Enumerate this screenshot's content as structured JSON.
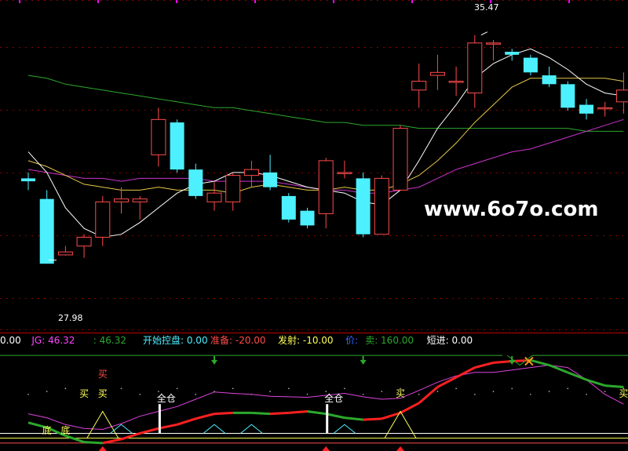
{
  "colors": {
    "up": "#ff4b4b",
    "down": "#4cf0ff",
    "ma_fast": "#ffffff",
    "ma_mid": "#e6c84a",
    "ma_slow": "#cc33cc",
    "ma_long": "#2ca82c",
    "grid": "#8a0000"
  },
  "watermark": "www.6o7o.com",
  "chart_data": [
    {
      "type": "candlestick",
      "ylim": [
        26.0,
        36.5
      ],
      "high_label": "35.47",
      "low_label": "27.98",
      "candles": [
        {
          "o": 30.6,
          "h": 30.8,
          "l": 30.2,
          "c": 30.5
        },
        {
          "o": 29.9,
          "h": 30.2,
          "l": 27.7,
          "c": 27.7
        },
        {
          "o": 28.0,
          "h": 28.3,
          "l": 27.98,
          "c": 28.1
        },
        {
          "o": 28.3,
          "h": 28.7,
          "l": 27.9,
          "c": 28.6
        },
        {
          "o": 28.6,
          "h": 30.0,
          "l": 28.3,
          "c": 29.8
        },
        {
          "o": 29.8,
          "h": 30.3,
          "l": 29.4,
          "c": 29.9
        },
        {
          "o": 29.8,
          "h": 30.0,
          "l": 29.2,
          "c": 29.9
        },
        {
          "o": 31.4,
          "h": 33.0,
          "l": 31.0,
          "c": 32.6
        },
        {
          "o": 32.5,
          "h": 32.6,
          "l": 30.8,
          "c": 30.9
        },
        {
          "o": 30.9,
          "h": 31.1,
          "l": 29.9,
          "c": 30.0
        },
        {
          "o": 29.8,
          "h": 30.5,
          "l": 29.5,
          "c": 30.1
        },
        {
          "o": 29.8,
          "h": 30.8,
          "l": 29.5,
          "c": 30.7
        },
        {
          "o": 30.7,
          "h": 31.2,
          "l": 30.3,
          "c": 30.9
        },
        {
          "o": 30.8,
          "h": 31.4,
          "l": 30.2,
          "c": 30.3
        },
        {
          "o": 30.0,
          "h": 30.1,
          "l": 29.1,
          "c": 29.2
        },
        {
          "o": 29.5,
          "h": 29.6,
          "l": 28.9,
          "c": 29.0
        },
        {
          "o": 29.4,
          "h": 31.3,
          "l": 28.9,
          "c": 31.2
        },
        {
          "o": 30.8,
          "h": 31.2,
          "l": 30.6,
          "c": 30.8
        },
        {
          "o": 30.6,
          "h": 30.8,
          "l": 28.6,
          "c": 28.7
        },
        {
          "o": 28.7,
          "h": 30.7,
          "l": 28.7,
          "c": 30.6
        },
        {
          "o": 30.2,
          "h": 32.4,
          "l": 30.2,
          "c": 32.3
        },
        {
          "o": 33.6,
          "h": 34.5,
          "l": 33.0,
          "c": 33.9
        },
        {
          "o": 34.1,
          "h": 34.8,
          "l": 33.6,
          "c": 34.2
        },
        {
          "o": 33.9,
          "h": 34.4,
          "l": 33.4,
          "c": 33.9
        },
        {
          "o": 33.5,
          "h": 35.47,
          "l": 33.0,
          "c": 35.2
        },
        {
          "o": 35.2,
          "h": 35.3,
          "l": 34.6,
          "c": 35.2
        },
        {
          "o": 34.9,
          "h": 35.0,
          "l": 34.6,
          "c": 34.8
        },
        {
          "o": 34.7,
          "h": 34.8,
          "l": 34.1,
          "c": 34.2
        },
        {
          "o": 34.1,
          "h": 34.4,
          "l": 33.7,
          "c": 33.8
        },
        {
          "o": 33.8,
          "h": 33.9,
          "l": 32.9,
          "c": 33.0
        },
        {
          "o": 33.1,
          "h": 33.3,
          "l": 32.6,
          "c": 32.8
        },
        {
          "o": 33.0,
          "h": 33.2,
          "l": 32.7,
          "c": 33.0
        },
        {
          "o": 33.2,
          "h": 34.2,
          "l": 32.8,
          "c": 33.6
        }
      ],
      "ma_fast": [
        31.5,
        30.8,
        29.6,
        28.9,
        28.6,
        28.7,
        29.1,
        29.6,
        30.1,
        30.4,
        30.5,
        30.8,
        30.8,
        30.7,
        30.5,
        30.3,
        30.2,
        30.1,
        29.8,
        29.7,
        30.2,
        31.2,
        32.3,
        33.1,
        34.0,
        34.5,
        34.8,
        35.0,
        34.7,
        34.3,
        33.8,
        33.5,
        33.4
      ],
      "ma_mid": [
        31.2,
        31.0,
        30.7,
        30.4,
        30.3,
        30.2,
        30.2,
        30.3,
        30.2,
        30.2,
        30.2,
        30.1,
        30.3,
        30.4,
        30.3,
        30.2,
        30.2,
        30.3,
        30.2,
        30.2,
        30.4,
        30.7,
        31.2,
        31.8,
        32.5,
        33.1,
        33.7,
        34.0,
        34.0,
        34.0,
        34.0,
        34.0,
        33.9
      ],
      "ma_slow": [
        30.9,
        30.8,
        30.7,
        30.6,
        30.6,
        30.5,
        30.6,
        30.6,
        30.6,
        30.6,
        30.5,
        30.5,
        30.5,
        30.5,
        30.4,
        30.3,
        30.2,
        30.2,
        30.1,
        30.1,
        30.2,
        30.3,
        30.6,
        30.9,
        31.1,
        31.3,
        31.5,
        31.6,
        31.8,
        32.0,
        32.2,
        32.4,
        32.6
      ],
      "ma_long": [
        34.1,
        34.0,
        33.8,
        33.7,
        33.6,
        33.5,
        33.4,
        33.3,
        33.2,
        33.1,
        33.0,
        33.0,
        32.9,
        32.8,
        32.7,
        32.6,
        32.5,
        32.5,
        32.4,
        32.4,
        32.4,
        32.3,
        32.3,
        32.3,
        32.3,
        32.3,
        32.3,
        32.3,
        32.3,
        32.3,
        32.2,
        32.2,
        32.2
      ]
    },
    {
      "type": "indicator",
      "legend_items": [
        {
          "text": "0.00",
          "color": "#ffffff"
        },
        {
          "text": "JG: 46.32",
          "color": "#ff44ff"
        },
        {
          "text": ": 46.32",
          "color": "#2ca82c"
        },
        {
          "text": "开始控盘: 0.00",
          "color": "#4cf0ff"
        },
        {
          "text": "准备: -20.00",
          "color": "#ff4b4b"
        },
        {
          "text": "发射: -10.00",
          "color": "#ffff55"
        },
        {
          "text": "价:",
          "color": "#3366ff"
        },
        {
          "text": "卖: 160.00",
          "color": "#2ca82c"
        },
        {
          "text": "短进: 0.00",
          "color": "#ffffff"
        }
      ],
      "ylim": [
        -25,
        165
      ],
      "jg_line": [
        40,
        32,
        18,
        10,
        8,
        20,
        35,
        45,
        55,
        70,
        85,
        82,
        80,
        76,
        75,
        74,
        78,
        82,
        75,
        70,
        72,
        88,
        105,
        118,
        125,
        125,
        130,
        135,
        140,
        135,
        110,
        80,
        60
      ],
      "main_line": [
        22,
        12,
        -5,
        -18,
        -20,
        -12,
        0,
        10,
        18,
        30,
        40,
        42,
        42,
        40,
        42,
        45,
        40,
        32,
        28,
        30,
        42,
        62,
        95,
        115,
        135,
        145,
        148,
        150,
        140,
        125,
        110,
        98,
        95
      ],
      "buy_labels": [
        {
          "i": 3,
          "v": 75,
          "text": "买"
        },
        {
          "i": 4,
          "v": 75,
          "text": "买"
        },
        {
          "i": 4,
          "v": 115,
          "text": "买"
        },
        {
          "i": 20,
          "v": 75,
          "text": "买"
        },
        {
          "i": 32,
          "v": 75,
          "text": "买"
        }
      ],
      "bottom_labels": [
        {
          "i": 1,
          "v": 2,
          "text": "底"
        },
        {
          "i": 2,
          "v": 2,
          "text": "底"
        }
      ],
      "full_labels": [
        {
          "i": 7,
          "text": "全仓"
        },
        {
          "i": 16,
          "text": "全仓"
        }
      ],
      "down_arrows": [
        10,
        18,
        26
      ],
      "up_arrows": [
        4,
        16,
        20
      ]
    }
  ]
}
